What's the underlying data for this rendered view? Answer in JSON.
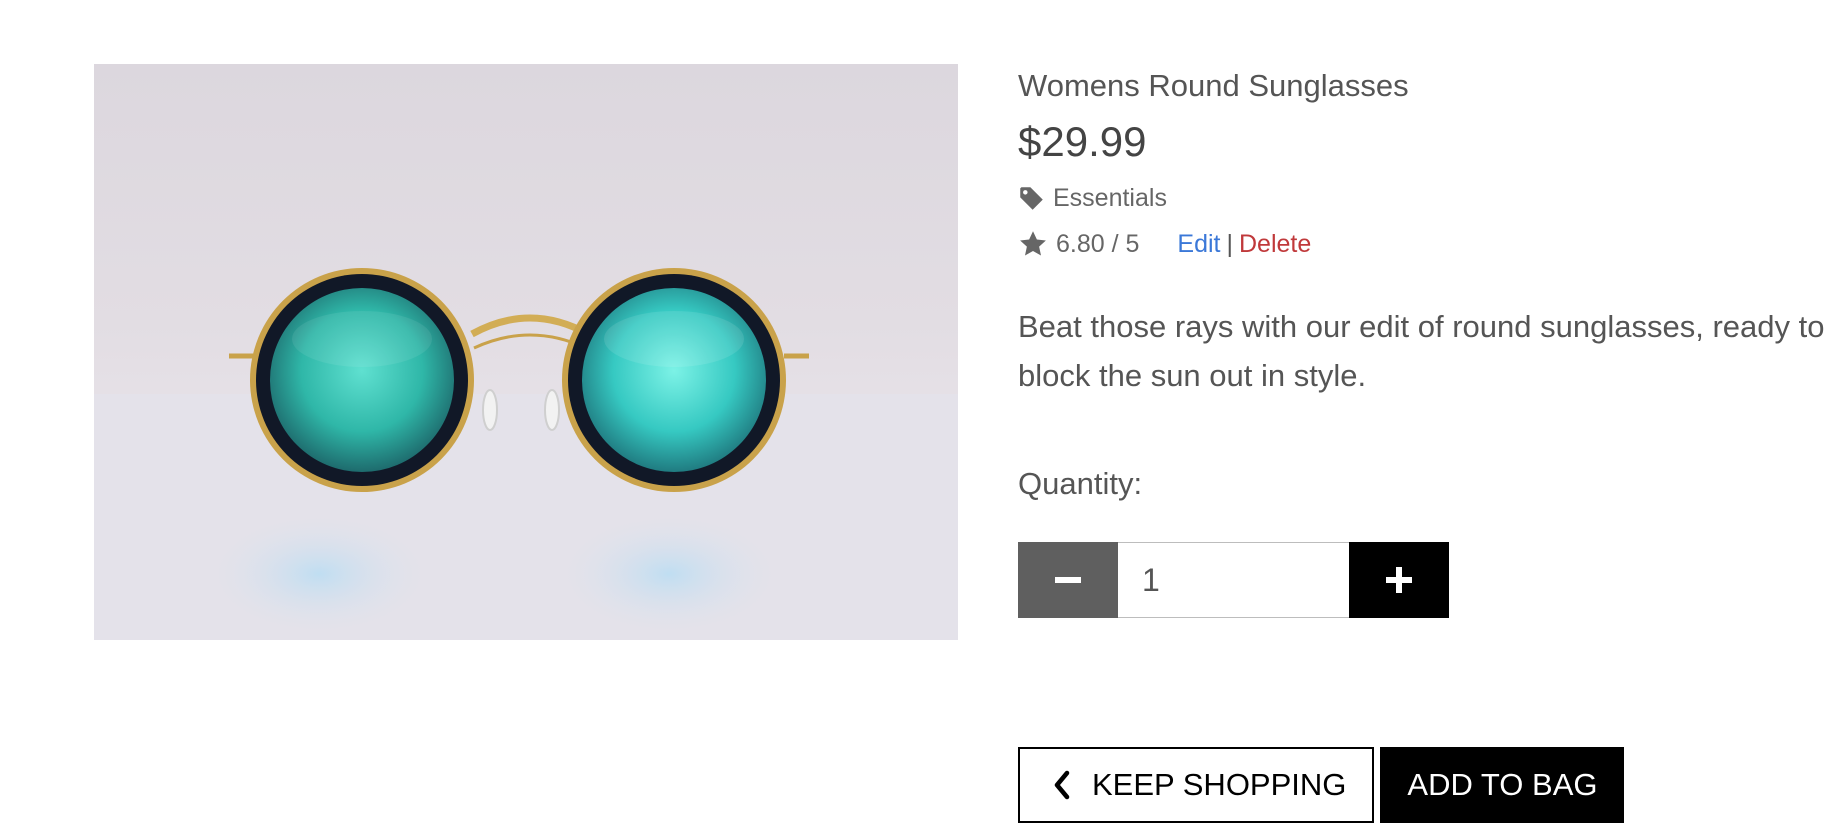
{
  "product": {
    "name": "Womens Round Sunglasses",
    "price": "$29.99",
    "category": "Essentials",
    "rating": "6.80 / 5",
    "description": "Beat those rays with our edit of round sunglasses, ready to block the sun out in style.",
    "image_icon": "sunglasses-product-photo"
  },
  "admin": {
    "edit_label": "Edit",
    "separator": "|",
    "delete_label": "Delete"
  },
  "quantity": {
    "label": "Quantity:",
    "value": "1"
  },
  "actions": {
    "keep_shopping_label": "KEEP SHOPPING",
    "add_to_bag_label": "ADD TO BAG"
  },
  "icons": {
    "category": "tag-icon",
    "rating": "star-icon",
    "decrement": "minus-icon",
    "increment": "plus-icon",
    "back": "chevron-left-icon"
  },
  "colors": {
    "edit_link": "#3b78d8",
    "delete_link": "#c0393b",
    "minus_button": "#5f5f5f",
    "plus_button": "#000000",
    "primary_button": "#000000"
  }
}
